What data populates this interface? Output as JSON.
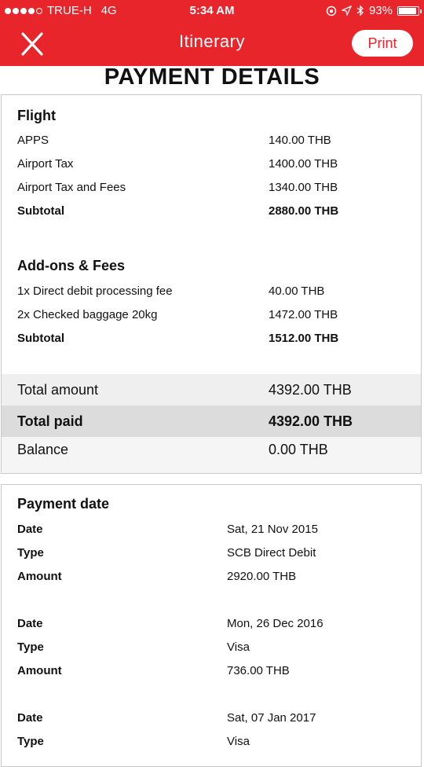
{
  "status_bar": {
    "carrier": "TRUE-H",
    "network": "4G",
    "time": "5:34 AM",
    "battery": "93%",
    "battery_level": 0.93
  },
  "nav": {
    "title": "Itinerary",
    "print_label": "Print"
  },
  "heading": "PAYMENT DETAILS",
  "flight": {
    "title": "Flight",
    "items": [
      {
        "label": "APPS",
        "value": "140.00 THB"
      },
      {
        "label": "Airport Tax",
        "value": "1400.00 THB"
      },
      {
        "label": "Airport Tax and Fees",
        "value": "1340.00 THB"
      }
    ],
    "subtotal_label": "Subtotal",
    "subtotal_value": "2880.00 THB"
  },
  "addons": {
    "title": "Add-ons & Fees",
    "items": [
      {
        "label": "1x Direct debit processing fee",
        "value": "40.00 THB"
      },
      {
        "label": "2x Checked baggage 20kg",
        "value": "1472.00 THB"
      }
    ],
    "subtotal_label": "Subtotal",
    "subtotal_value": "1512.00 THB"
  },
  "totals": {
    "total_amount_label": "Total amount",
    "total_amount_value": "4392.00 THB",
    "total_paid_label": "Total paid",
    "total_paid_value": "4392.00 THB",
    "balance_label": "Balance",
    "balance_value": "0.00 THB"
  },
  "payment_date": {
    "title": "Payment date",
    "entries": [
      {
        "date_label": "Date",
        "date": "Sat, 21 Nov 2015",
        "type_label": "Type",
        "type": "SCB Direct Debit",
        "amount_label": "Amount",
        "amount": "2920.00 THB"
      },
      {
        "date_label": "Date",
        "date": "Mon, 26 Dec 2016",
        "type_label": "Type",
        "type": "Visa",
        "amount_label": "Amount",
        "amount": "736.00 THB"
      },
      {
        "date_label": "Date",
        "date": "Sat, 07 Jan 2017",
        "type_label": "Type",
        "type": "Visa"
      }
    ]
  },
  "colors": {
    "brand_red": "#e8252b"
  }
}
